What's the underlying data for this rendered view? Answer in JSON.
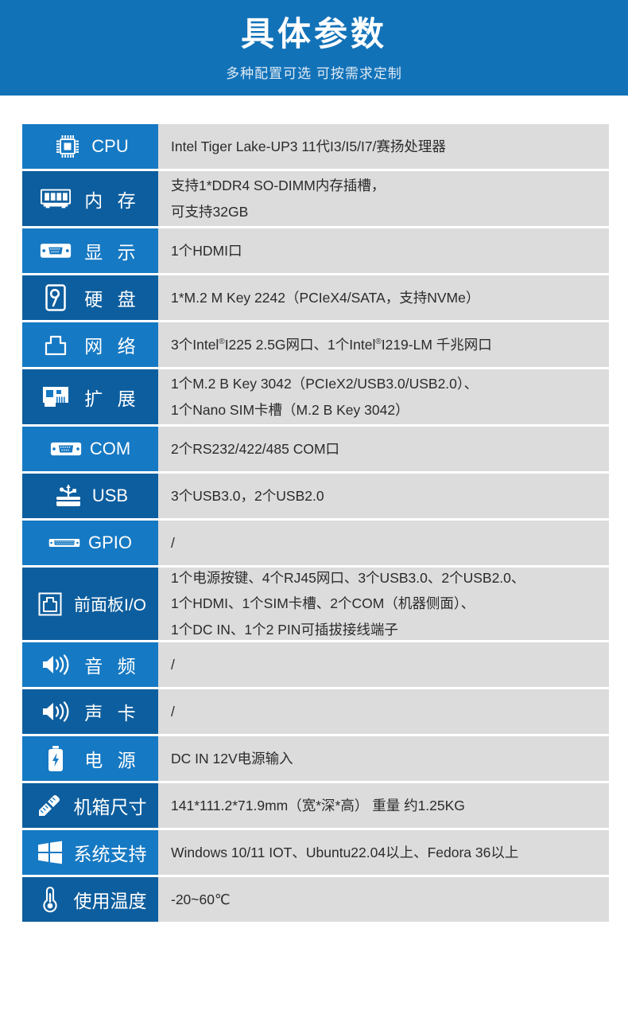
{
  "header": {
    "title": "具体参数",
    "subtitle": "多种配置可选 可按需求定制",
    "bg_color": "#1272b8"
  },
  "colors": {
    "label_light": "#1679c3",
    "label_dark": "#0d5e9e",
    "value_bg": "#dcdcdc",
    "value_text": "#2b2b2b",
    "page_bg": "#ffffff"
  },
  "spec_rows": [
    {
      "icon": "cpu-chip-icon",
      "label": "CPU",
      "lines": [
        "Intel Tiger Lake-UP3 11代I3/I5/I7/赛扬处理器"
      ]
    },
    {
      "icon": "memory-ram-icon",
      "label": "内 存",
      "lines": [
        "支持1*DDR4 SO-DIMM内存插槽，",
        "可支持32GB"
      ]
    },
    {
      "icon": "vga-display-icon",
      "label": "显 示",
      "lines": [
        "1个HDMI口"
      ]
    },
    {
      "icon": "hard-disk-icon",
      "label": "硬 盘",
      "lines": [
        "1*M.2 M Key 2242（PCIeX4/SATA，支持NVMe）"
      ]
    },
    {
      "icon": "rj45-network-icon",
      "label": "网 络",
      "lines": [
        "3个Intel®I225 2.5G网口、1个Intel®I219-LM 千兆网口"
      ]
    },
    {
      "icon": "expansion-card-icon",
      "label": "扩 展",
      "lines": [
        "1个M.2 B Key 3042（PCIeX2/USB3.0/USB2.0）、",
        "1个Nano SIM卡槽（M.2 B Key 3042）"
      ]
    },
    {
      "icon": "db9-serial-port-icon",
      "label": "COM",
      "lines": [
        "2个RS232/422/485 COM口"
      ]
    },
    {
      "icon": "usb-port-icon",
      "label": "USB",
      "lines": [
        "3个USB3.0，2个USB2.0"
      ]
    },
    {
      "icon": "gpio-connector-icon",
      "label": "GPIO",
      "lines": [
        "/"
      ]
    },
    {
      "icon": "front-panel-io-icon",
      "label": "前面板I/O",
      "lines": [
        "1个电源按键、4个RJ45网口、3个USB3.0、2个USB2.0、",
        "1个HDMI、1个SIM卡槽、2个COM（机器侧面）、",
        "1个DC IN、1个2 PIN可插拔接线端子"
      ]
    },
    {
      "icon": "speaker-audio-icon",
      "label": "音 频",
      "lines": [
        "/"
      ]
    },
    {
      "icon": "speaker-audio-icon",
      "label": "声 卡",
      "lines": [
        "/"
      ]
    },
    {
      "icon": "battery-power-icon",
      "label": "电 源",
      "lines": [
        "DC IN 12V电源输入"
      ]
    },
    {
      "icon": "ruler-pencil-icon",
      "label": "机箱尺寸",
      "lines": [
        "141*111.2*71.9mm（宽*深*高） 重量 约1.25KG"
      ]
    },
    {
      "icon": "windows-logo-icon",
      "label": "系统支持",
      "lines": [
        "Windows 10/11 IOT、Ubuntu22.04以上、Fedora 36以上"
      ]
    },
    {
      "icon": "thermometer-icon",
      "label": "使用温度",
      "lines": [
        "-20~60℃"
      ]
    }
  ]
}
